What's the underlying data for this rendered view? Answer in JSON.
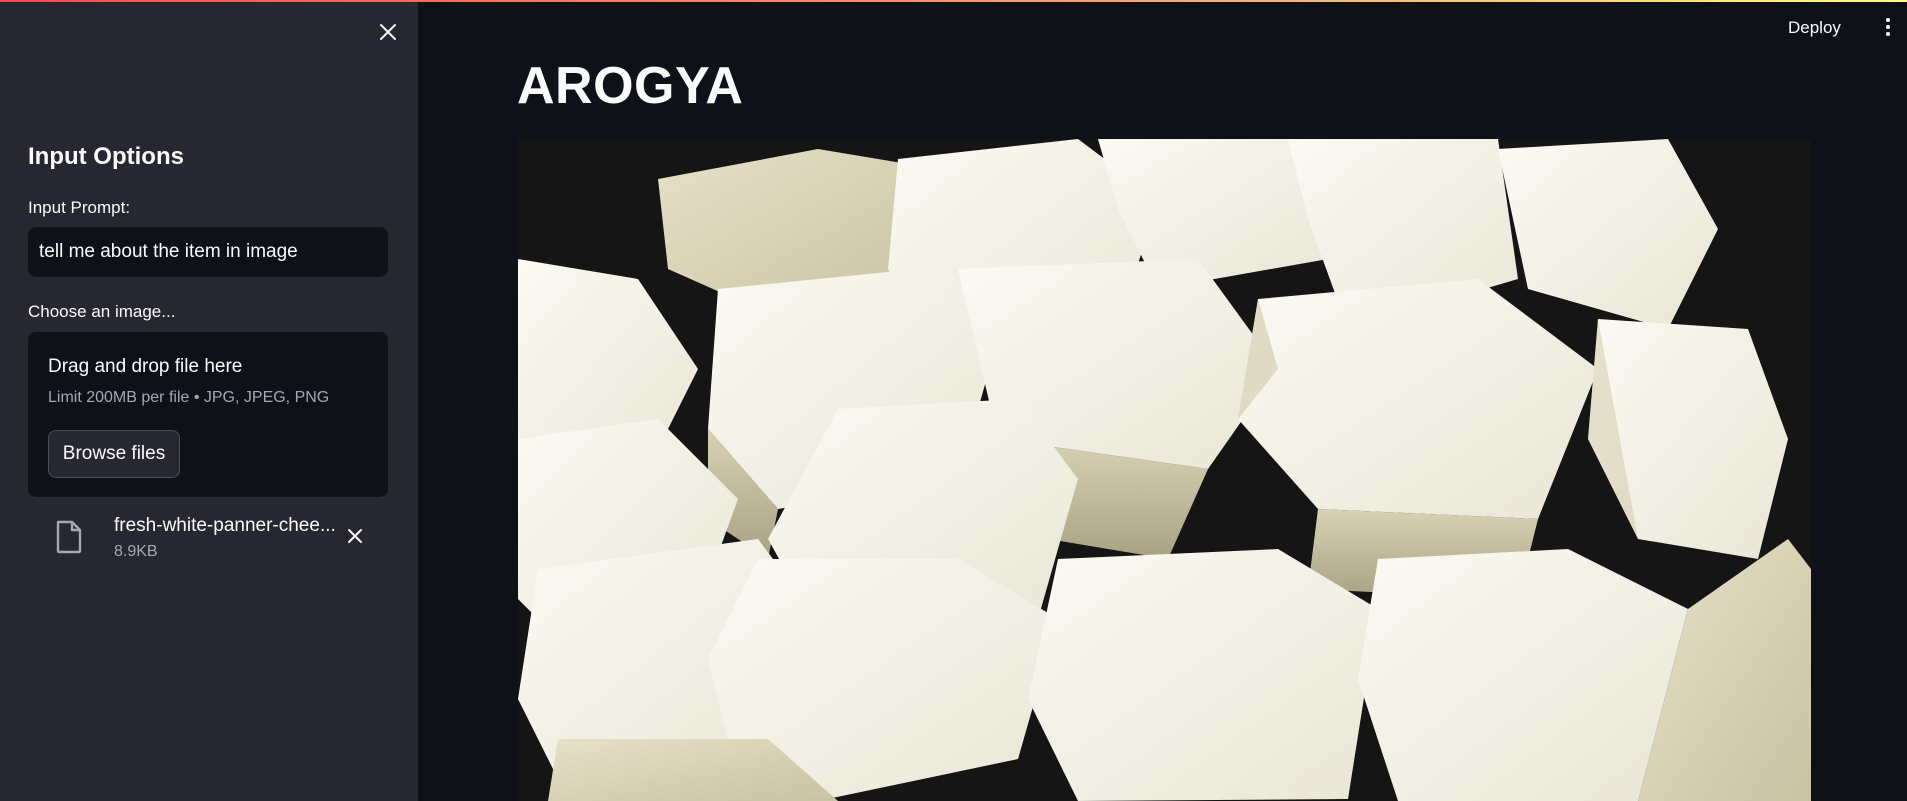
{
  "app": {
    "title": "AROGYA"
  },
  "header": {
    "deploy_label": "Deploy",
    "menu_icon": "kebab-vertical-icon"
  },
  "sidebar": {
    "close_icon": "close-icon",
    "section_title": "Input Options",
    "prompt": {
      "label": "Input Prompt:",
      "value": "tell me about the item in image"
    },
    "uploader": {
      "label": "Choose an image...",
      "drop_title": "Drag and drop file here",
      "limit_text": "Limit 200MB per file • JPG, JPEG, PNG",
      "browse_label": "Browse files"
    },
    "uploaded_file": {
      "icon": "file-icon",
      "name": "fresh-white-panner-chee...",
      "size": "8.9KB",
      "remove_icon": "close-icon"
    }
  },
  "main": {
    "image": {
      "subject": "paneer-cubes-photo"
    }
  },
  "colors": {
    "background": "#0e1117",
    "sidebar": "#262730",
    "text": "#fafafa",
    "muted": "#a3a8b8",
    "accent_gradient_start": "#ff4b4b",
    "accent_gradient_end": "#fffd80"
  }
}
